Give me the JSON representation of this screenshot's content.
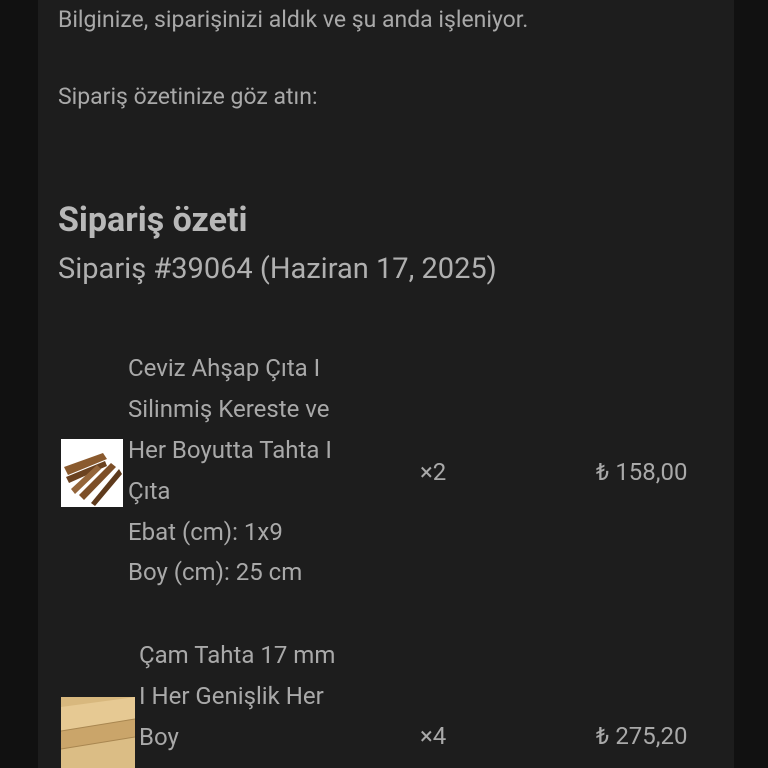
{
  "intro": {
    "line1": "Bilginize, siparişinizi aldık ve şu anda işleniyor.",
    "line2": "Sipariş özetinize göz atın:"
  },
  "summary": {
    "title": "Sipariş özeti",
    "order": "Sipariş #39064 (Haziran 17, 2025)"
  },
  "items": [
    {
      "name_lines": [
        "Ceviz Ahşap Çıta I",
        "Silinmiş Kereste ve",
        "Her Boyutta Tahta I",
        "Çıta"
      ],
      "meta_lines": [
        "Ebat (cm): 1x9",
        "Boy (cm): 25 cm"
      ],
      "quantity": "×2",
      "price": "₺ 158,00",
      "image": "walnut-wood-slats-thumbnail"
    },
    {
      "name_lines": [
        "Çam Tahta 17 mm",
        "I Her Genişlik Her",
        "Boy"
      ],
      "quantity": "×4",
      "price": "₺ 275,20",
      "image": "pine-board-thumbnail"
    }
  ]
}
